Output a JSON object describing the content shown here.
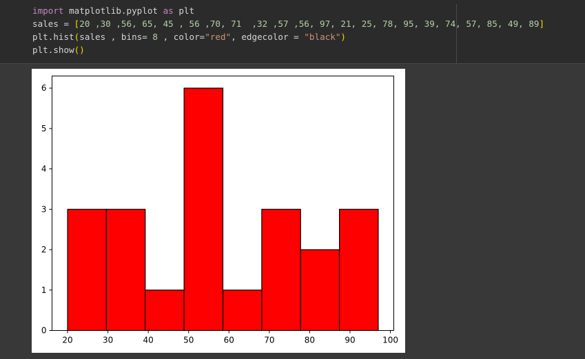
{
  "code": {
    "line1": {
      "import_kw": "import",
      "module": " matplotlib.pyplot ",
      "as_kw": "as",
      "alias": " plt"
    },
    "line2": {
      "text_before": "sales = ",
      "open": "[",
      "values": "20 ,30 ,56, 65, 45 , 56 ,70, 71  ,32 ,57 ,56, 97, 21, 25, 78, 95, 39, 74, 57, 85, 49, 89",
      "close": "]"
    },
    "line3": {
      "call": "plt.hist",
      "open": "(",
      "args_a": "sales , bins= ",
      "bins": "8",
      "args_b": " , color=",
      "color_str": "\"red\"",
      "args_c": ", edgecolor = ",
      "edge_str": "\"black\"",
      "close": ")"
    },
    "line4": {
      "call": "plt.show",
      "parens": "()"
    }
  },
  "colors": {
    "bar_fill": "#ff0000",
    "bar_edge": "#000000",
    "keyword": "#c586c0",
    "string": "#ce9178",
    "number": "#b5cea8",
    "bracket": "#ffd700"
  },
  "chart_data": {
    "type": "bar",
    "title": "",
    "xlabel": "",
    "ylabel": "",
    "bins": [
      {
        "start": 20.0,
        "end": 29.625,
        "count": 3
      },
      {
        "start": 29.625,
        "end": 39.25,
        "count": 3
      },
      {
        "start": 39.25,
        "end": 48.875,
        "count": 1
      },
      {
        "start": 48.875,
        "end": 58.5,
        "count": 6
      },
      {
        "start": 58.5,
        "end": 68.125,
        "count": 1
      },
      {
        "start": 68.125,
        "end": 77.75,
        "count": 3
      },
      {
        "start": 77.75,
        "end": 87.375,
        "count": 2
      },
      {
        "start": 87.375,
        "end": 97.0,
        "count": 3
      }
    ],
    "xlim": [
      16.15,
      100.85
    ],
    "ylim": [
      0,
      6.3
    ],
    "x_ticks": [
      20,
      30,
      40,
      50,
      60,
      70,
      80,
      90,
      100
    ],
    "y_ticks": [
      0,
      1,
      2,
      3,
      4,
      5,
      6
    ],
    "grid": false,
    "legend": "none"
  }
}
